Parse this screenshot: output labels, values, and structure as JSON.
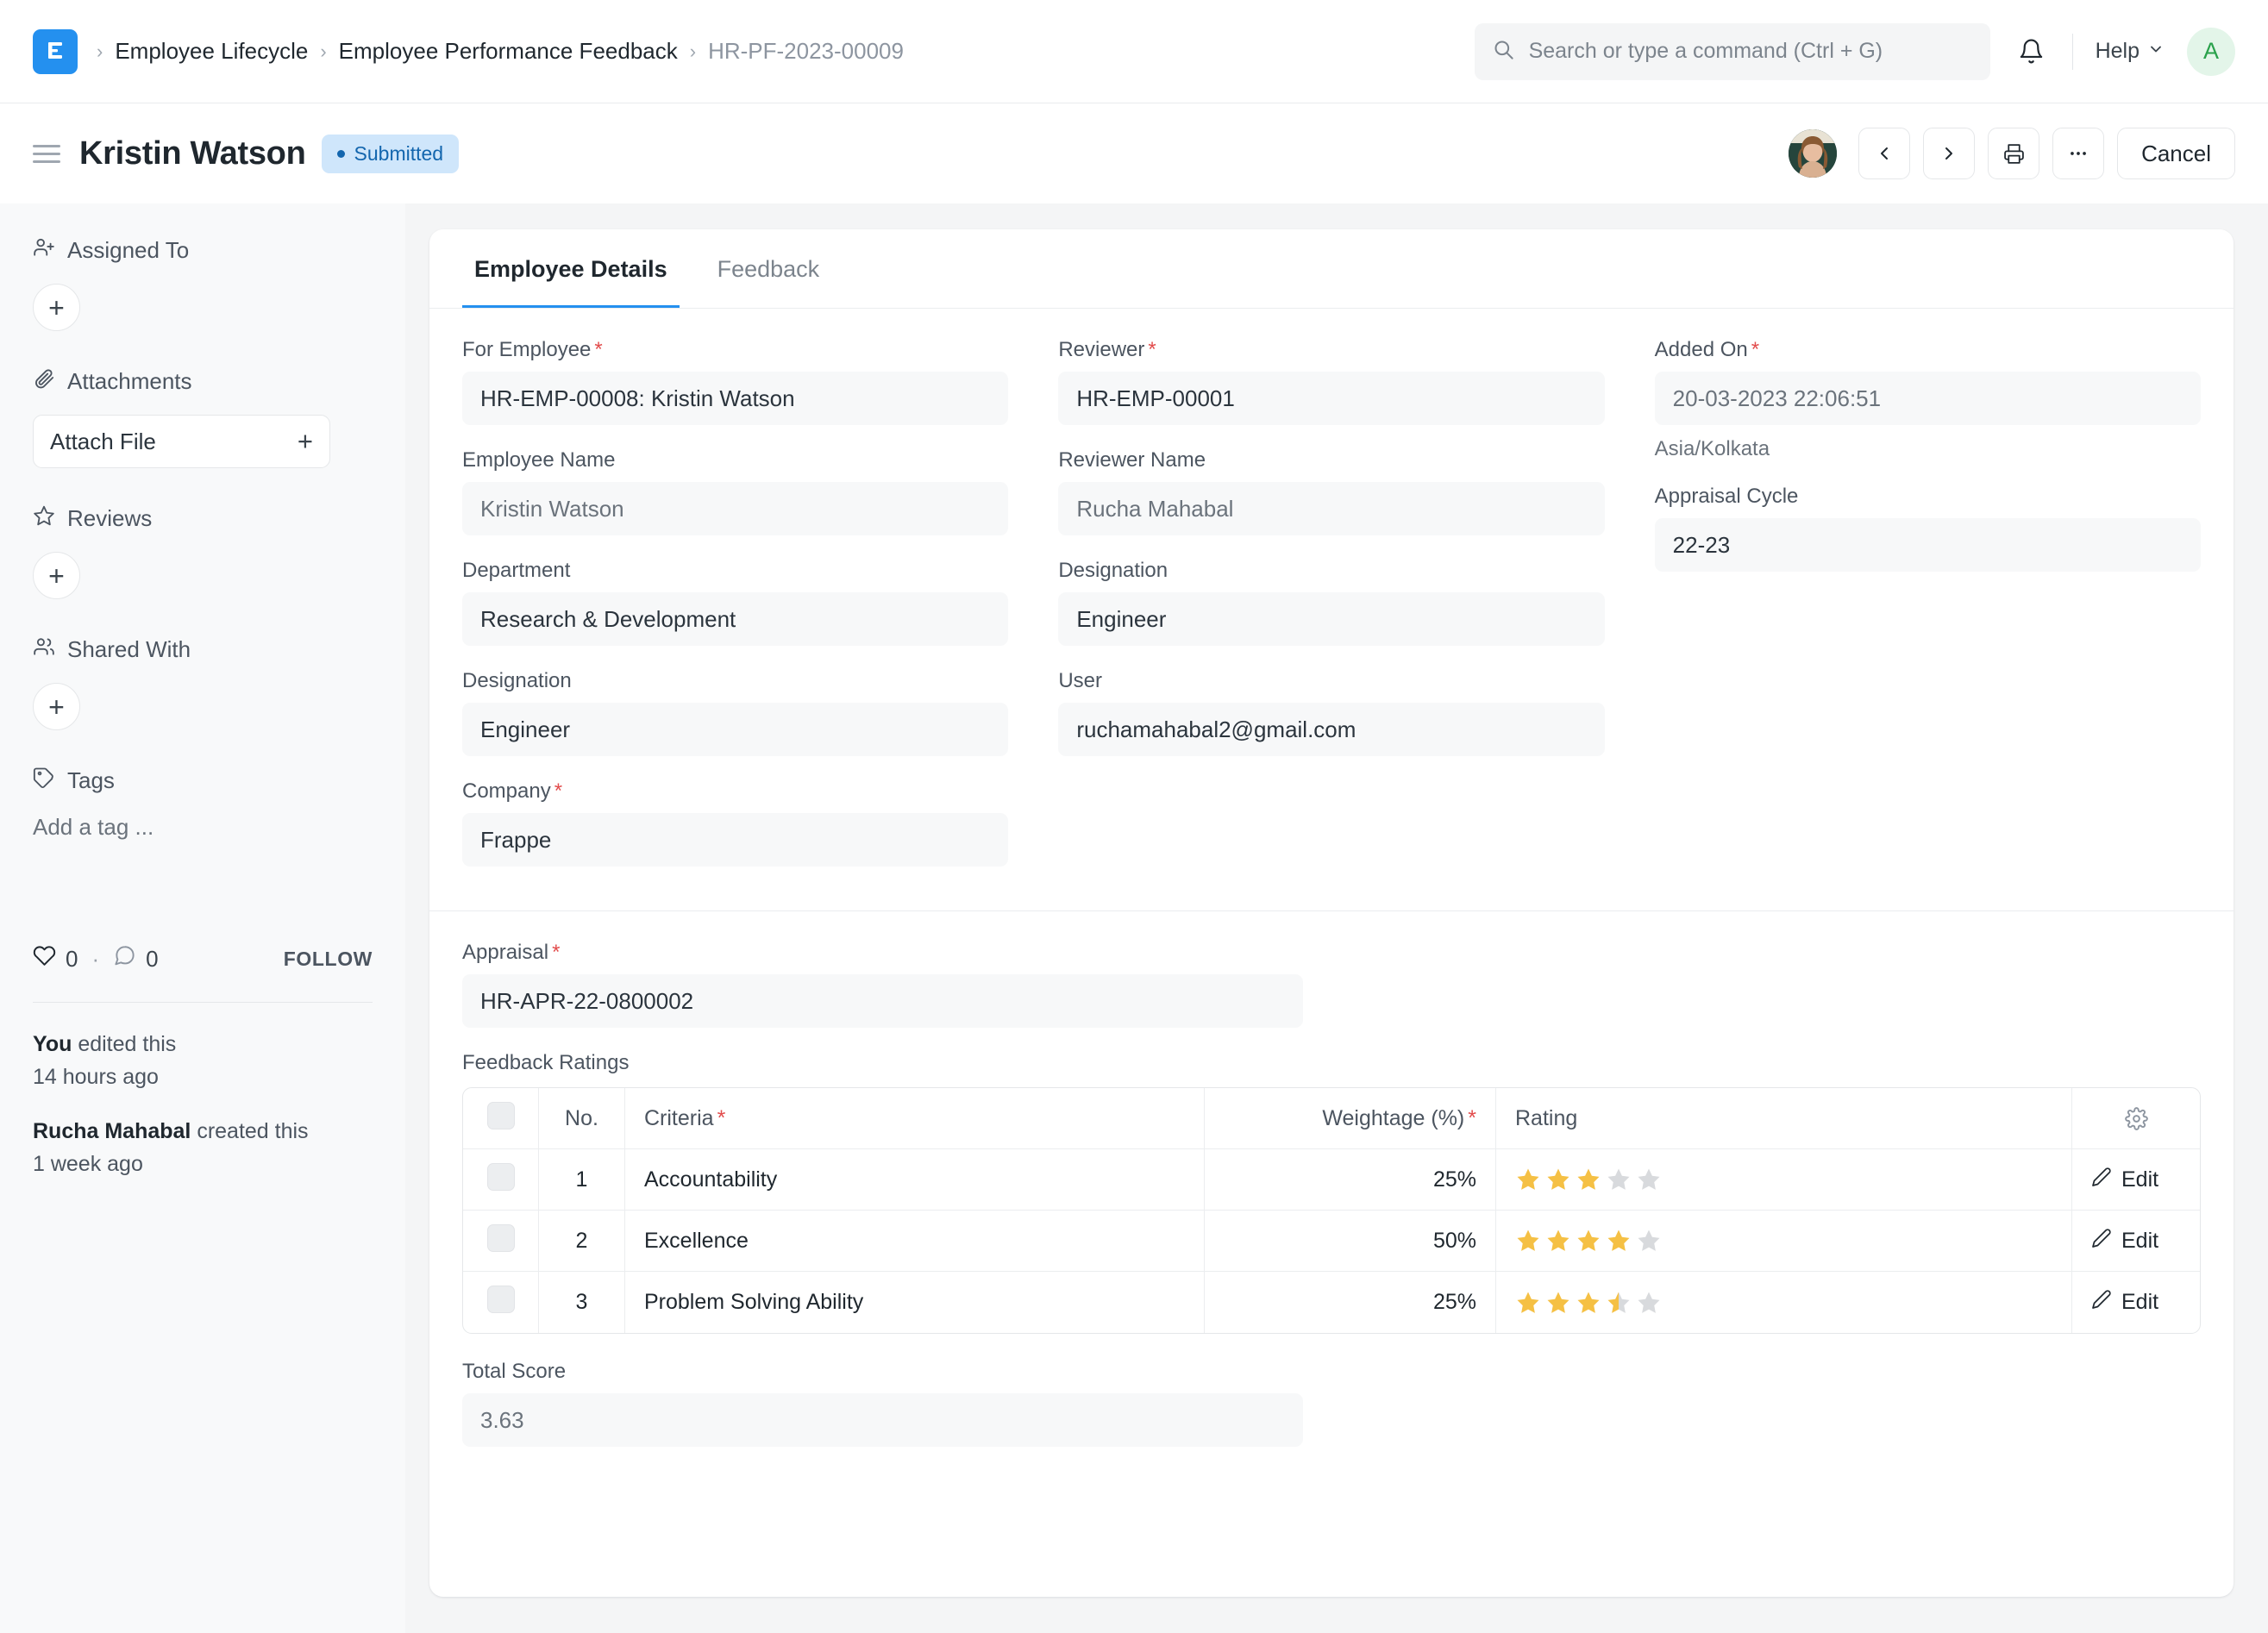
{
  "navbar": {
    "logo_icon": "frappe-logo-icon",
    "breadcrumbs": [
      {
        "label": "Employee Lifecycle"
      },
      {
        "label": "Employee Performance Feedback"
      },
      {
        "label": "HR-PF-2023-00009"
      }
    ],
    "separator": "›",
    "search": {
      "icon": "search-icon",
      "placeholder": "Search or type a command (Ctrl + G)",
      "value": ""
    },
    "notifications_icon": "bell-icon",
    "help_label": "Help",
    "help_chevron_icon": "chevron-down-icon",
    "user_avatar_initial": "A",
    "colors": {
      "brand_blue": "#2490ef",
      "avatar_green": "#29a14b",
      "avatar_green_bg": "#e3f5e9"
    }
  },
  "titlebar": {
    "menu_icon": "hamburger-menu-icon",
    "title": "Kristin Watson",
    "status": {
      "label": "Submitted",
      "color": "#1366ae",
      "bg": "#cfe6fb"
    },
    "assignee_avatar": "user-photo-avatar",
    "prev_icon": "chevron-left-icon",
    "next_icon": "chevron-right-icon",
    "print_icon": "printer-icon",
    "more_icon": "ellipsis-icon",
    "cancel_label": "Cancel"
  },
  "sidebar": {
    "assigned_to": {
      "icon": "user-plus-icon",
      "label": "Assigned To",
      "add_label": "+"
    },
    "attachments": {
      "icon": "paperclip-icon",
      "label": "Attachments",
      "attach_label": "Attach File",
      "attach_plus": "+"
    },
    "reviews": {
      "icon": "star-outline-icon",
      "label": "Reviews",
      "add_label": "+"
    },
    "shared_with": {
      "icon": "users-icon",
      "label": "Shared With",
      "add_label": "+"
    },
    "tags": {
      "icon": "tag-icon",
      "label": "Tags",
      "placeholder": "Add a tag ..."
    },
    "social": {
      "like_icon": "heart-icon",
      "like_count": "0",
      "separator": "·",
      "comment_icon": "comment-icon",
      "comment_count": "0",
      "follow_label": "FOLLOW"
    },
    "activity": [
      {
        "actor": "You",
        "action": " edited this",
        "time": "14 hours ago"
      },
      {
        "actor": "Rucha Mahabal",
        "action": " created this",
        "time": "1 week ago"
      }
    ]
  },
  "main": {
    "tabs": [
      {
        "label": "Employee Details",
        "active": true
      },
      {
        "label": "Feedback",
        "active": false
      }
    ],
    "fields": {
      "for_employee": {
        "label": "For Employee",
        "required": true,
        "value": "HR-EMP-00008: Kristin Watson",
        "muted": false
      },
      "employee_name": {
        "label": "Employee Name",
        "required": false,
        "value": "Kristin Watson",
        "muted": true
      },
      "department": {
        "label": "Department",
        "required": false,
        "value": "Research & Development",
        "muted": false
      },
      "designation_l": {
        "label": "Designation",
        "required": false,
        "value": "Engineer",
        "muted": false
      },
      "company": {
        "label": "Company",
        "required": true,
        "value": "Frappe",
        "muted": false
      },
      "reviewer": {
        "label": "Reviewer",
        "required": true,
        "value": "HR-EMP-00001",
        "muted": false
      },
      "reviewer_name": {
        "label": "Reviewer Name",
        "required": false,
        "value": "Rucha Mahabal",
        "muted": true
      },
      "designation_m": {
        "label": "Designation",
        "required": false,
        "value": "Engineer",
        "muted": false
      },
      "user": {
        "label": "User",
        "required": false,
        "value": "ruchamahabal2@gmail.com",
        "muted": false
      },
      "added_on": {
        "label": "Added On",
        "required": true,
        "value": "20-03-2023 22:06:51",
        "muted": true,
        "helper": "Asia/Kolkata"
      },
      "appraisal_cycle": {
        "label": "Appraisal Cycle",
        "required": false,
        "value": "22-23",
        "muted": false
      },
      "appraisal": {
        "label": "Appraisal",
        "required": true,
        "value": "HR-APR-22-0800002",
        "muted": false
      },
      "total_score": {
        "label": "Total Score",
        "required": false,
        "value": "3.63",
        "muted": true
      }
    },
    "feedback_ratings": {
      "section_label": "Feedback Ratings",
      "settings_icon": "gear-icon",
      "columns": [
        {
          "label": "",
          "key": "check"
        },
        {
          "label": "No.",
          "key": "no"
        },
        {
          "label": "Criteria",
          "key": "criteria",
          "required": true
        },
        {
          "label": "Weightage (%)",
          "key": "weightage",
          "required": true
        },
        {
          "label": "Rating",
          "key": "rating"
        },
        {
          "label": "",
          "key": "actions"
        }
      ],
      "rows": [
        {
          "no": "1",
          "criteria": "Accountability",
          "weightage": "25%",
          "rating": 3,
          "edit_label": "Edit",
          "edit_icon": "pencil-icon"
        },
        {
          "no": "2",
          "criteria": "Excellence",
          "weightage": "50%",
          "rating": 4,
          "edit_label": "Edit",
          "edit_icon": "pencil-icon"
        },
        {
          "no": "3",
          "criteria": "Problem Solving Ability",
          "weightage": "25%",
          "rating": 3.5,
          "edit_label": "Edit",
          "edit_icon": "pencil-icon"
        }
      ],
      "max_rating": 5,
      "star_filled_color": "#f5c044",
      "star_empty_color": "#d8dadd"
    }
  }
}
